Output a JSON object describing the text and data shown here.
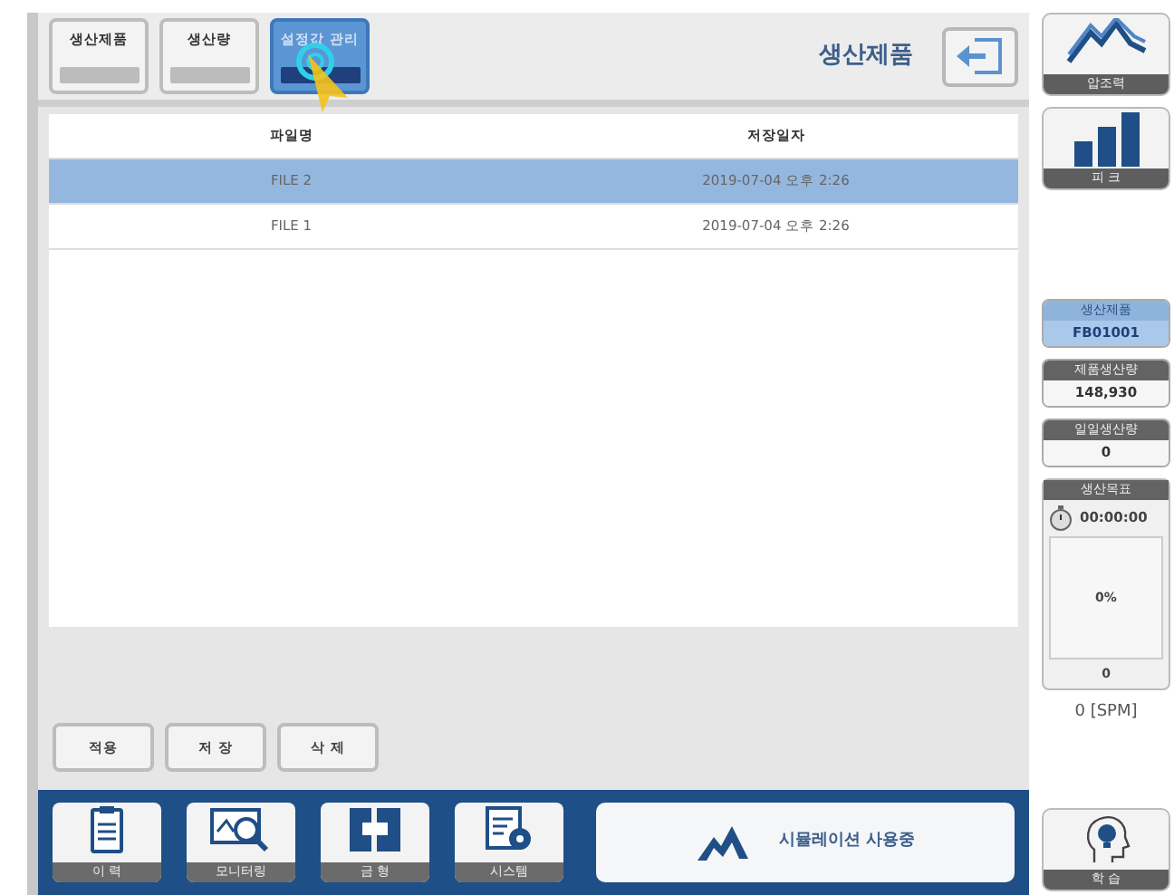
{
  "tabs": [
    {
      "label": "생산제품",
      "selected": false
    },
    {
      "label": "생산량",
      "selected": false
    },
    {
      "label": "설정값 관리",
      "selected": true
    }
  ],
  "title": "생산제품",
  "table": {
    "columns": [
      "파일명",
      "저장일자"
    ],
    "rows": [
      {
        "cells": [
          "FILE 2",
          "2019-07-04 오후 2:26"
        ],
        "selected": true
      },
      {
        "cells": [
          "FILE 1",
          "2019-07-04 오후 2:26"
        ],
        "selected": false
      }
    ]
  },
  "actions": [
    "적용",
    "저 장",
    "삭 제"
  ],
  "nav": [
    {
      "label": "이 력",
      "kind": "history"
    },
    {
      "label": "모니터링",
      "kind": "monitor"
    },
    {
      "label": "금 형",
      "kind": "mold"
    },
    {
      "label": "시스템",
      "kind": "system"
    }
  ],
  "simulation": "시뮬레이션 사용중",
  "side_buttons": [
    {
      "label": "압조력",
      "kind": "wave"
    },
    {
      "label": "피 크",
      "kind": "bars"
    }
  ],
  "info": [
    {
      "label": "생산제품",
      "value": "FB01001",
      "kind": "product"
    },
    {
      "label": "제품생산량",
      "value": "148,930",
      "kind": "plain"
    },
    {
      "label": "일일생산량",
      "value": "0",
      "kind": "plain"
    }
  ],
  "goal": {
    "label": "생산목표",
    "time": "00:00:00",
    "percent": "0%",
    "count": "0"
  },
  "spm": "0 [SPM]",
  "learn_button": "학 습"
}
